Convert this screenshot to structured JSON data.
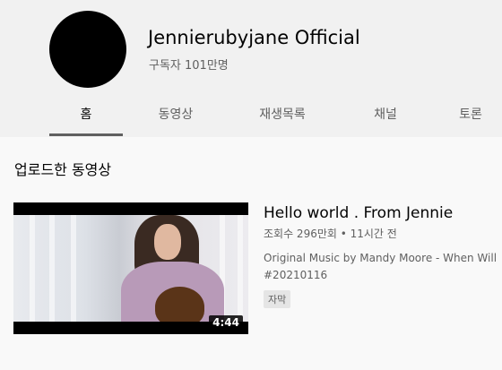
{
  "channel": {
    "name": "Jennierubyjane Official",
    "subscribers": "구독자 101만명"
  },
  "tabs": [
    {
      "label": "홈",
      "active": true
    },
    {
      "label": "동영상",
      "active": false
    },
    {
      "label": "재생목록",
      "active": false
    },
    {
      "label": "채널",
      "active": false
    },
    {
      "label": "토론",
      "active": false
    }
  ],
  "section": {
    "title": "업로드한 동영상"
  },
  "video": {
    "duration": "4:44",
    "title": "Hello world . From Jennie",
    "meta": "조회수 296만회 • 11시간 전",
    "description_lines": [
      "Original Music by Mandy Moore - When Will",
      "#20210116"
    ],
    "badge": "자막"
  },
  "colors": {
    "header_bg": "#f1f1f1",
    "page_bg": "#f9f9f9",
    "text_primary": "#030303",
    "text_secondary": "#606060"
  }
}
